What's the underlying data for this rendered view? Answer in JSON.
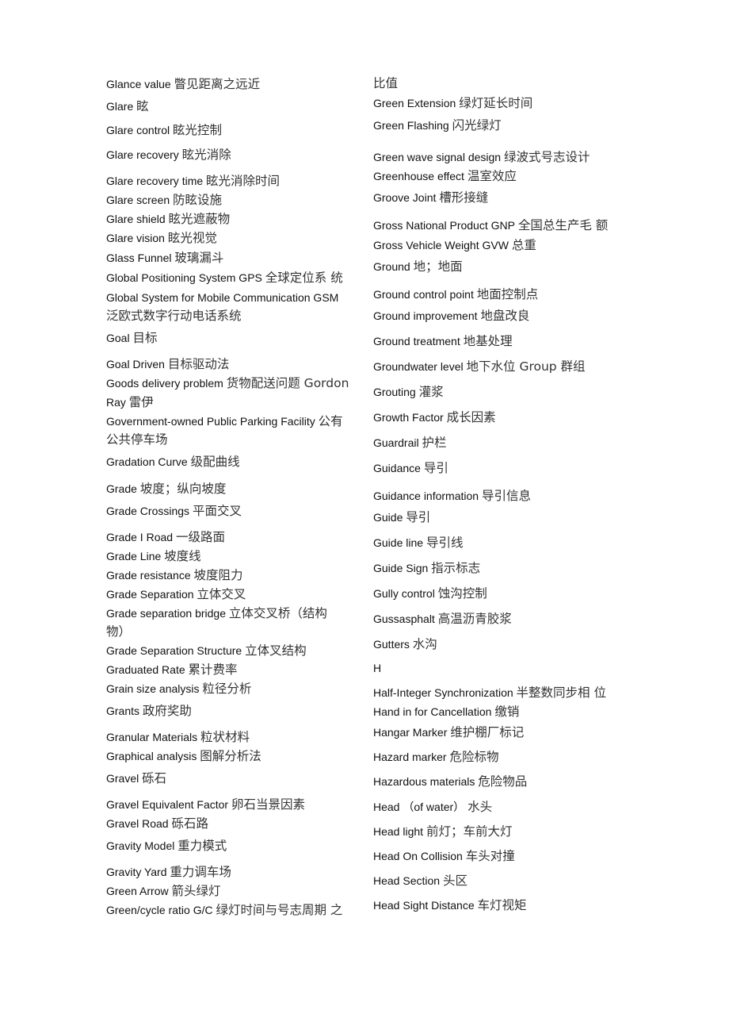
{
  "document": {
    "left_column": [
      {
        "en": "Glance value",
        "zh": "瞥见距离之远近"
      },
      {
        "en": "Glare",
        "zh": "眩"
      },
      {
        "en": "Glare control",
        "zh": "眩光控制"
      },
      {
        "en": "Glare recovery",
        "zh": "眩光消除"
      },
      {
        "en": "Glare recovery time",
        "zh": "眩光消除时间"
      },
      {
        "en": "Glare screen",
        "zh": "防眩设施"
      },
      {
        "en": "Glare shield",
        "zh": "眩光遮蔽物"
      },
      {
        "en": "Glare vision",
        "zh": "眩光视觉"
      },
      {
        "en": "Glass Funnel",
        "zh": "玻璃漏斗"
      },
      {
        "en": "Global Positioning System GPS",
        "zh": "全球定位系  统"
      },
      {
        "en": "Global System for Mobile Communication GSM",
        "zh": ""
      },
      {
        "en": "",
        "zh": "泛欧式数字行动电话系统"
      },
      {
        "en": "Goal",
        "zh": "目标"
      },
      {
        "en": "Goal Driven",
        "zh": "目标驱动法"
      },
      {
        "en": "Goods delivery problem",
        "zh": "货物配送问题  Gordon"
      },
      {
        "en": "Ray",
        "zh": "雷伊"
      },
      {
        "en": "Government-owned Public Parking Facility",
        "zh": "公有"
      },
      {
        "en": "",
        "zh": "公共停车场"
      },
      {
        "en": "Gradation Curve",
        "zh": "级配曲线"
      },
      {
        "en": "Grade",
        "zh": "坡度；纵向坡度"
      },
      {
        "en": "Grade Crossings",
        "zh": "平面交叉"
      },
      {
        "en": "Grade I Road",
        "zh": "一级路面"
      },
      {
        "en": "Grade Line",
        "zh": "坡度线"
      },
      {
        "en": "Grade resistance",
        "zh": "坡度阻力"
      },
      {
        "en": "Grade Separation",
        "zh": "立体交叉"
      },
      {
        "en": "Grade separation bridge",
        "zh": "立体交叉桥（结构"
      },
      {
        "en": "",
        "zh": "物）"
      },
      {
        "en": "Grade Separation Structure",
        "zh": "立体叉结构"
      },
      {
        "en": "Graduated Rate",
        "zh": "累计费率"
      },
      {
        "en": "Grain size analysis",
        "zh": "粒径分析"
      },
      {
        "en": "Grants",
        "zh": "政府奖助"
      },
      {
        "en": "Granular Materials",
        "zh": "粒状材料"
      },
      {
        "en": "Graphical analysis",
        "zh": "图解分析法"
      },
      {
        "en": "Gravel",
        "zh": "砾石"
      },
      {
        "en": "Gravel Equivalent Factor",
        "zh": "卵石当景因素"
      },
      {
        "en": "Gravel Road",
        "zh": "砾石路"
      },
      {
        "en": "Gravity Model",
        "zh": "重力模式"
      },
      {
        "en": "Gravity Yard",
        "zh": "重力调车场"
      },
      {
        "en": "Green Arrow",
        "zh": "箭头绿灯"
      },
      {
        "en": "Green/cycle ratio G/C",
        "zh": "绿灯时间与号志周期  之"
      }
    ],
    "right_column": [
      {
        "en": "",
        "zh": "比值"
      },
      {
        "en": "Green Extension",
        "zh": "绿灯延长时间"
      },
      {
        "en": "Green Flashing",
        "zh": "闪光绿灯"
      },
      {
        "en": "Green wave signal design",
        "zh": "绿波式号志设计"
      },
      {
        "en": "Greenhouse effect",
        "zh": "温室效应"
      },
      {
        "en": "Groove Joint",
        "zh": "槽形接缝"
      },
      {
        "en": "Gross National Product GNP",
        "zh": "全国总生产毛  额"
      },
      {
        "en": "Gross Vehicle Weight GVW",
        "zh": "总重"
      },
      {
        "en": "Ground",
        "zh": "地；地面"
      },
      {
        "en": "Ground control point",
        "zh": "地面控制点"
      },
      {
        "en": "Ground improvement",
        "zh": "地盘改良"
      },
      {
        "en": "Ground treatment",
        "zh": "地基处理"
      },
      {
        "en": "Groundwater level",
        "zh": "地下水位  Group 群组"
      },
      {
        "en": "Grouting",
        "zh": "灌浆"
      },
      {
        "en": "Growth Factor",
        "zh": "成长因素"
      },
      {
        "en": "Guardrail",
        "zh": "护栏"
      },
      {
        "en": "Guidance",
        "zh": "导引"
      },
      {
        "en": "Guidance information",
        "zh": "导引信息"
      },
      {
        "en": "Guide",
        "zh": "导引"
      },
      {
        "en": "Guide line",
        "zh": "导引线"
      },
      {
        "en": "Guide Sign",
        "zh": "指示标志"
      },
      {
        "en": "Gully control",
        "zh": "蚀沟控制"
      },
      {
        "en": "Gussasphalt",
        "zh": "高温沥青胶浆"
      },
      {
        "en": "Gutters",
        "zh": "水沟"
      },
      {
        "en": "H",
        "zh": ""
      },
      {
        "en": "Half-Integer Synchronization",
        "zh": "半整数同步相  位"
      },
      {
        "en": "Hand in for Cancellation",
        "zh": "缴销"
      },
      {
        "en": "Hangar Marker",
        "zh": "维护棚厂标记"
      },
      {
        "en": "Hazard marker",
        "zh": "危险标物"
      },
      {
        "en": "Hazardous materials",
        "zh": "危险物品"
      },
      {
        "en": "Head （of water）",
        "zh": "水头"
      },
      {
        "en": "Head light",
        "zh": "前灯；车前大灯"
      },
      {
        "en": "Head On Collision",
        "zh": "车头对撞"
      },
      {
        "en": "Head Section",
        "zh": "头区"
      },
      {
        "en": "Head Sight Distance",
        "zh": "车灯视矩"
      }
    ]
  }
}
